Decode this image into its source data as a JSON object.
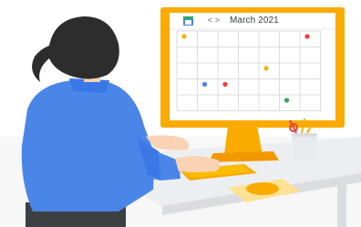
{
  "calendar": {
    "nav_arrows": "< >",
    "month_title": "March 2021",
    "app_icon": "calendar-icon",
    "event_dots": [
      {
        "row": 0,
        "col": 0,
        "color": "#f4b400"
      },
      {
        "row": 0,
        "col": 6,
        "color": "#ea4335"
      },
      {
        "row": 2,
        "col": 4,
        "color": "#f4b400"
      },
      {
        "row": 3,
        "col": 1,
        "color": "#4285f4"
      },
      {
        "row": 3,
        "col": 2,
        "color": "#ea4335"
      },
      {
        "row": 4,
        "col": 5,
        "color": "#34a853"
      }
    ]
  },
  "colors": {
    "monitor_frame": "#f9ab00",
    "sweater": "#4a86e8",
    "hair": "#2d2d2d",
    "skin": "#fad2b4",
    "desk": "#f1f3f4"
  }
}
